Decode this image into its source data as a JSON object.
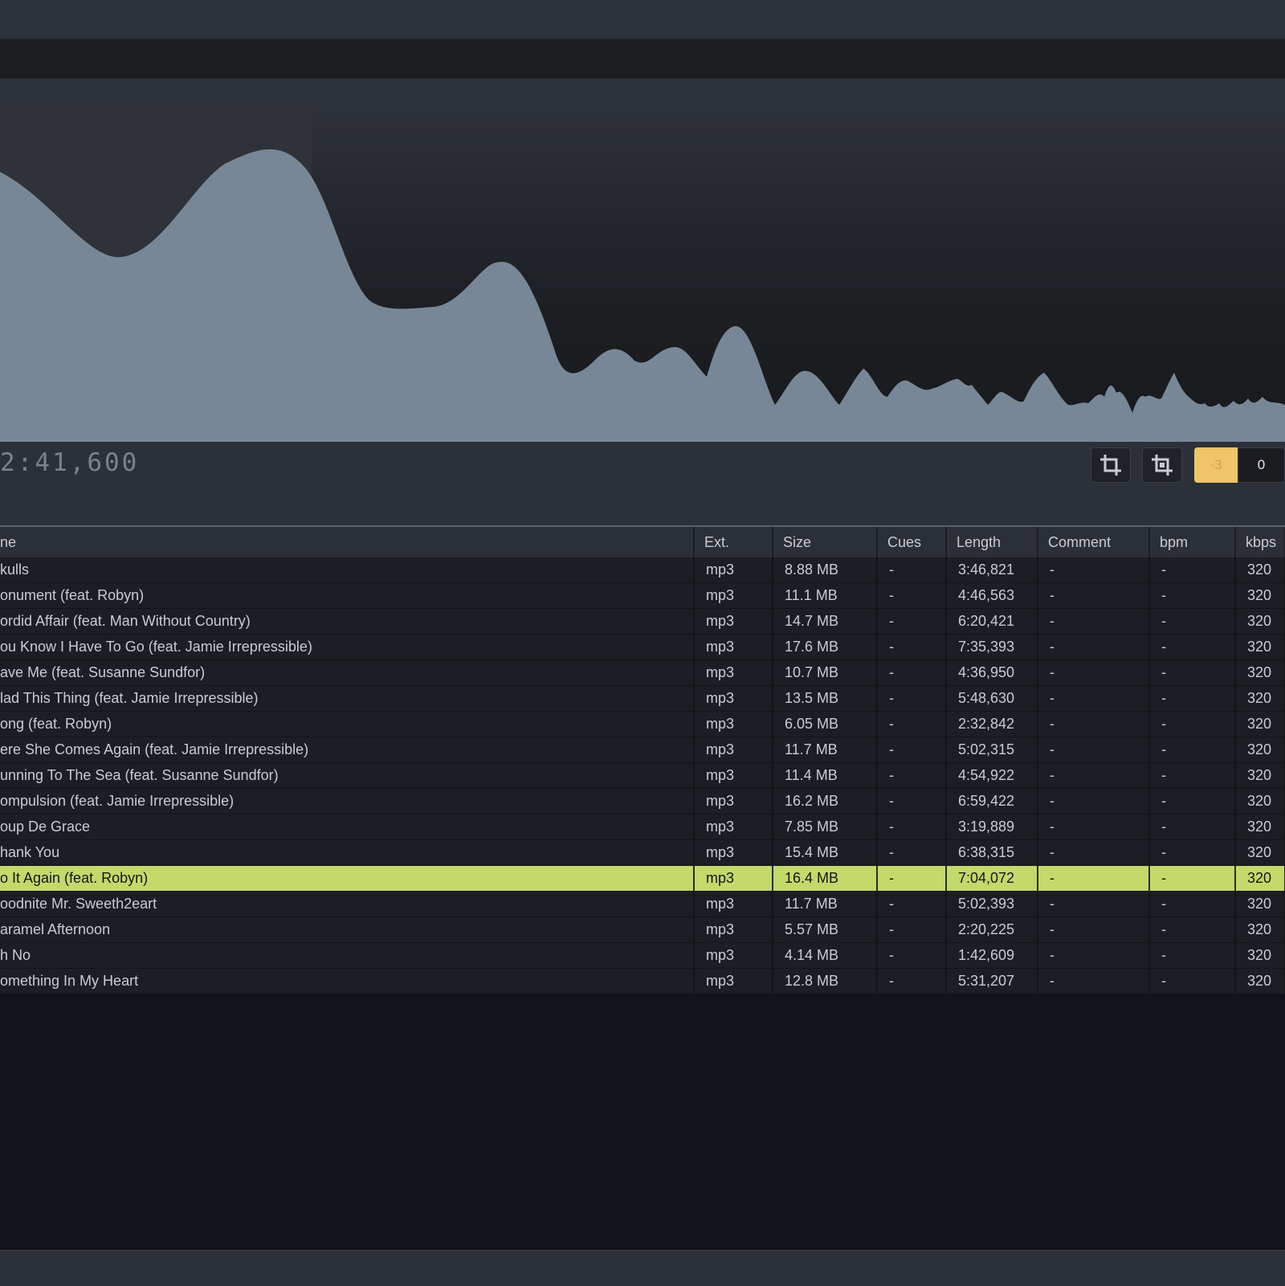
{
  "transport": {
    "time": "2:41,600"
  },
  "toolbar": {
    "crop_icon": "crop-icon",
    "crop_alt_icon": "crop-frame-icon",
    "gain_minus": "-3",
    "gain_zero": "0"
  },
  "colors": {
    "waveform_played": "#778797",
    "waveform_unplayed": "#778797",
    "selection_row": "#c3d96a",
    "gain_active": "#f0c469"
  },
  "table": {
    "columns": [
      "ne",
      "Ext.",
      "Size",
      "Cues",
      "Length",
      "Comment",
      "bpm",
      "kbps"
    ],
    "rows": [
      {
        "name": "kulls",
        "ext": "mp3",
        "size": "8.88 MB",
        "cues": "-",
        "length": "3:46,821",
        "comment": "-",
        "bpm": "-",
        "kbps": "320"
      },
      {
        "name": "onument (feat. Robyn)",
        "ext": "mp3",
        "size": "11.1 MB",
        "cues": "-",
        "length": "4:46,563",
        "comment": "-",
        "bpm": "-",
        "kbps": "320"
      },
      {
        "name": "ordid Affair (feat. Man Without Country)",
        "ext": "mp3",
        "size": "14.7 MB",
        "cues": "-",
        "length": "6:20,421",
        "comment": "-",
        "bpm": "-",
        "kbps": "320"
      },
      {
        "name": "ou Know I Have To Go (feat. Jamie Irrepressible)",
        "ext": "mp3",
        "size": "17.6 MB",
        "cues": "-",
        "length": "7:35,393",
        "comment": "-",
        "bpm": "-",
        "kbps": "320"
      },
      {
        "name": "ave Me (feat. Susanne Sundfor)",
        "ext": "mp3",
        "size": "10.7 MB",
        "cues": "-",
        "length": "4:36,950",
        "comment": "-",
        "bpm": "-",
        "kbps": "320"
      },
      {
        "name": "lad This Thing (feat. Jamie Irrepressible)",
        "ext": "mp3",
        "size": "13.5 MB",
        "cues": "-",
        "length": "5:48,630",
        "comment": "-",
        "bpm": "-",
        "kbps": "320"
      },
      {
        "name": "ong (feat. Robyn)",
        "ext": "mp3",
        "size": "6.05 MB",
        "cues": "-",
        "length": "2:32,842",
        "comment": "-",
        "bpm": "-",
        "kbps": "320"
      },
      {
        "name": "ere She Comes Again (feat. Jamie Irrepressible)",
        "ext": "mp3",
        "size": "11.7 MB",
        "cues": "-",
        "length": "5:02,315",
        "comment": "-",
        "bpm": "-",
        "kbps": "320"
      },
      {
        "name": "unning To The Sea (feat. Susanne Sundfor)",
        "ext": "mp3",
        "size": "11.4 MB",
        "cues": "-",
        "length": "4:54,922",
        "comment": "-",
        "bpm": "-",
        "kbps": "320"
      },
      {
        "name": "ompulsion (feat. Jamie Irrepressible)",
        "ext": "mp3",
        "size": "16.2 MB",
        "cues": "-",
        "length": "6:59,422",
        "comment": "-",
        "bpm": "-",
        "kbps": "320"
      },
      {
        "name": "oup De Grace",
        "ext": "mp3",
        "size": "7.85 MB",
        "cues": "-",
        "length": "3:19,889",
        "comment": "-",
        "bpm": "-",
        "kbps": "320"
      },
      {
        "name": "hank You",
        "ext": "mp3",
        "size": "15.4 MB",
        "cues": "-",
        "length": "6:38,315",
        "comment": "-",
        "bpm": "-",
        "kbps": "320"
      },
      {
        "name": "o It Again (feat. Robyn)",
        "ext": "mp3",
        "size": "16.4 MB",
        "cues": "-",
        "length": "7:04,072",
        "comment": "-",
        "bpm": "-",
        "kbps": "320",
        "selected": true
      },
      {
        "name": "oodnite Mr. Sweeth2eart",
        "ext": "mp3",
        "size": "11.7 MB",
        "cues": "-",
        "length": "5:02,393",
        "comment": "-",
        "bpm": "-",
        "kbps": "320"
      },
      {
        "name": "aramel Afternoon",
        "ext": "mp3",
        "size": "5.57 MB",
        "cues": "-",
        "length": "2:20,225",
        "comment": "-",
        "bpm": "-",
        "kbps": "320"
      },
      {
        "name": "h No",
        "ext": "mp3",
        "size": "4.14 MB",
        "cues": "-",
        "length": "1:42,609",
        "comment": "-",
        "bpm": "-",
        "kbps": "320"
      },
      {
        "name": "omething In My Heart",
        "ext": "mp3",
        "size": "12.8 MB",
        "cues": "-",
        "length": "5:31,207",
        "comment": "-",
        "bpm": "-",
        "kbps": "320"
      }
    ]
  }
}
